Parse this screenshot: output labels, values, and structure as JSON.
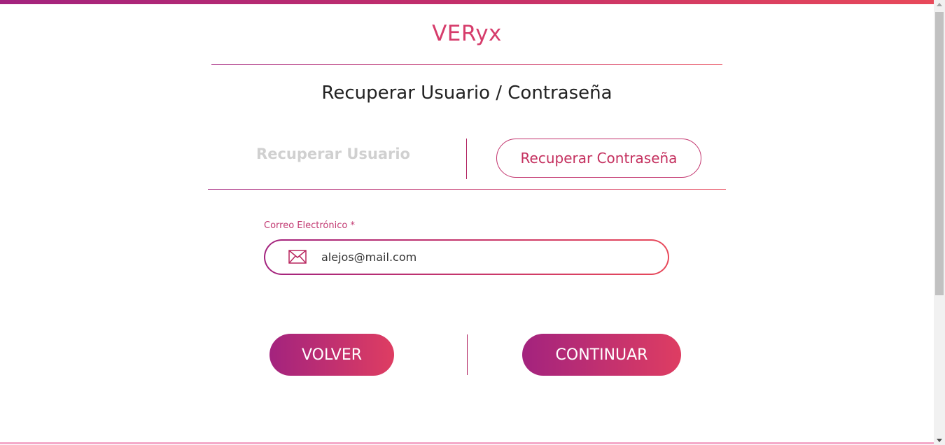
{
  "brand": {
    "name": "VERyx"
  },
  "page": {
    "title": "Recuperar Usuario / Contraseña"
  },
  "tabs": [
    {
      "label": "Recuperar Usuario",
      "active": false
    },
    {
      "label": "Recuperar Contraseña",
      "active": true
    }
  ],
  "form": {
    "email_label": "Correo Electrónico *",
    "email_value": "alejos@mail.com",
    "email_icon": "mail-icon"
  },
  "actions": {
    "back_label": "VOLVER",
    "continue_label": "CONTINUAR"
  },
  "colors": {
    "accent_start": "#a3237e",
    "accent_end": "#e8495a",
    "brand": "#d63c6b",
    "inactive_tab": "#d0d0d0"
  }
}
